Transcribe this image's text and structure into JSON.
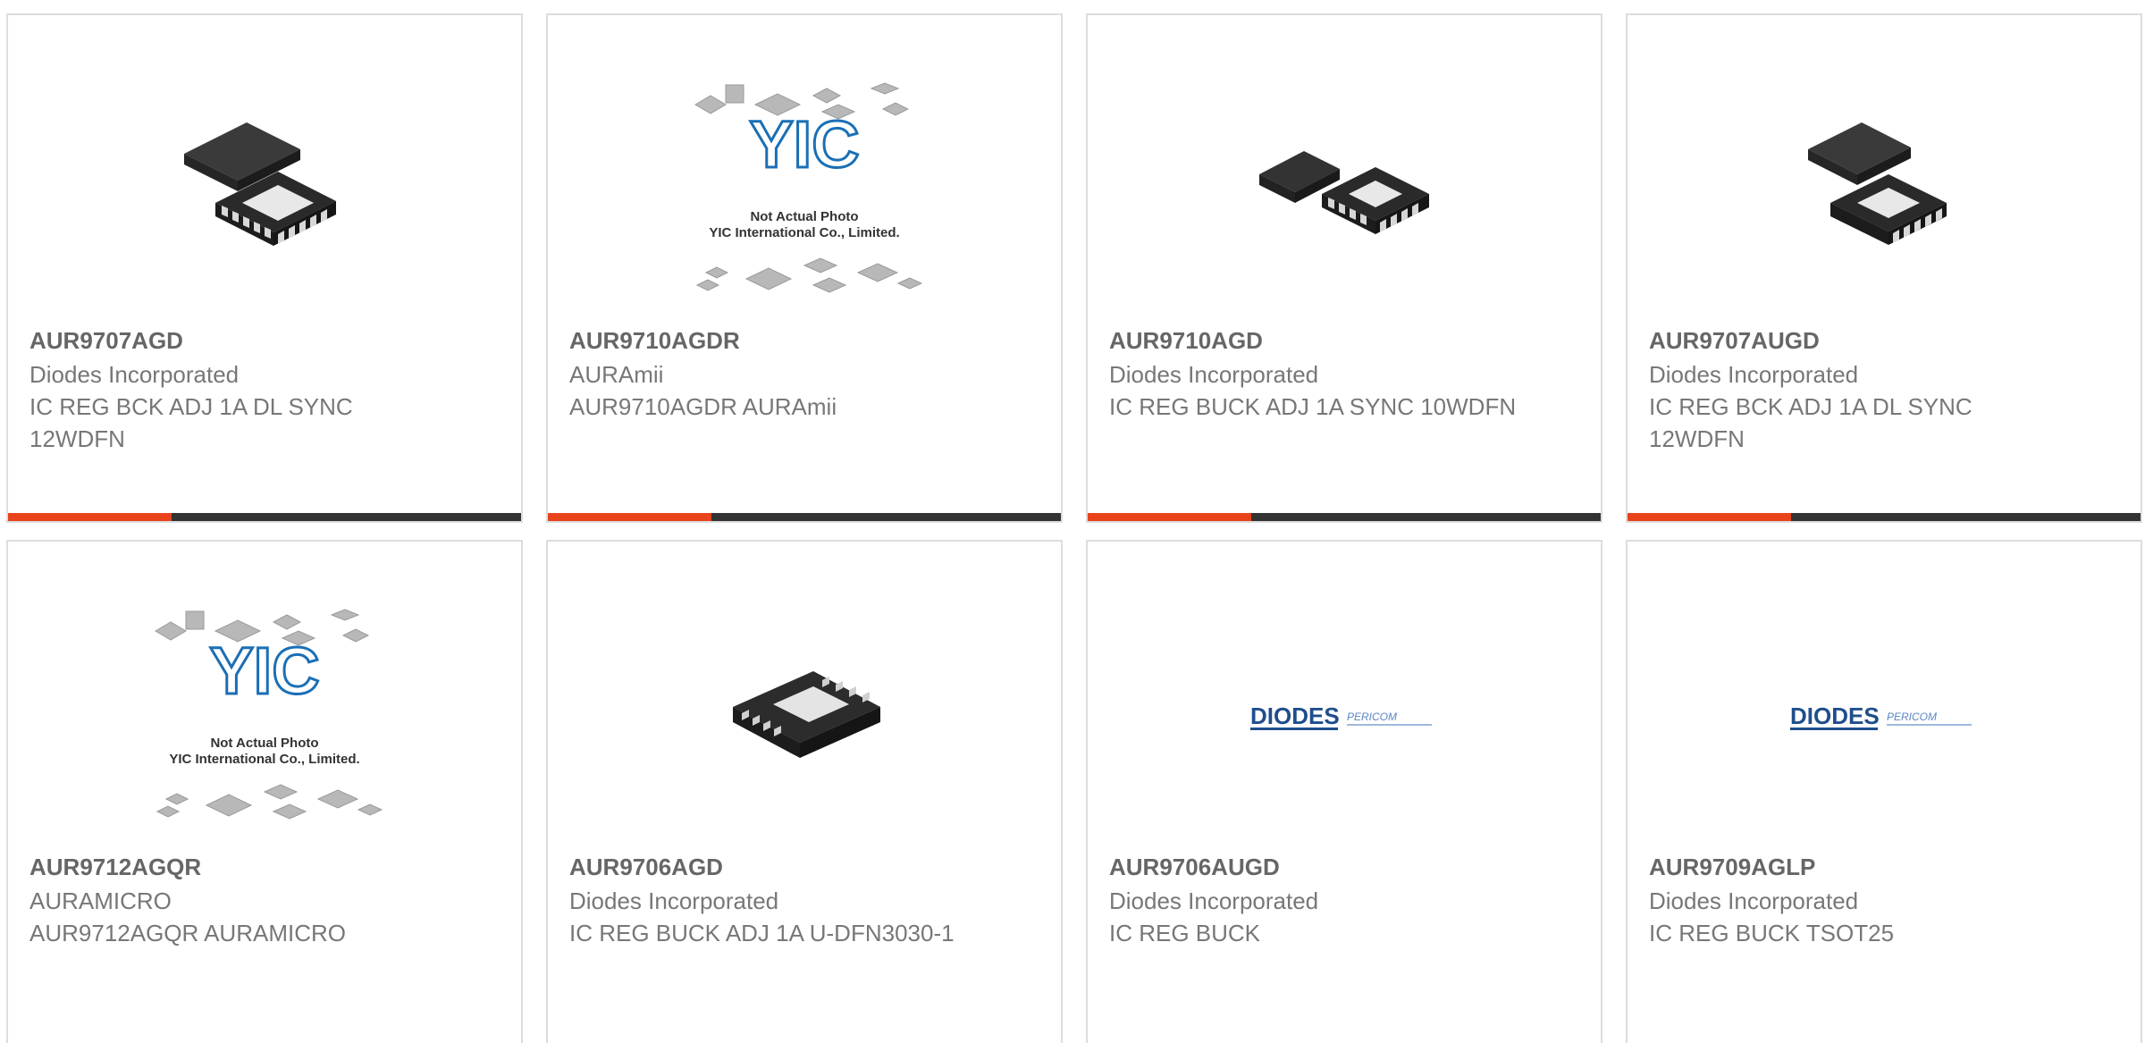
{
  "products": [
    {
      "part_number": "AUR9707AGD",
      "manufacturer": "Diodes Incorporated",
      "description": "IC REG BCK ADJ 1A DL SYNC 12WDFN",
      "image": "chip-stacked-icon"
    },
    {
      "part_number": "AUR9710AGDR",
      "manufacturer": "AURAmii",
      "description": "AUR9710AGDR AURAmii",
      "image": "placeholder-icon",
      "image_caption_line1": "Not Actual Photo",
      "image_caption_line2": "YIC International Co., Limited.",
      "image_logo": "YIC"
    },
    {
      "part_number": "AUR9710AGD",
      "manufacturer": "Diodes Incorporated",
      "description": "IC REG BUCK ADJ 1A SYNC 10WDFN",
      "image": "chip-pair-icon"
    },
    {
      "part_number": "AUR9707AUGD",
      "manufacturer": "Diodes Incorporated",
      "description": "IC REG BCK ADJ 1A DL SYNC 12WDFN",
      "image": "chip-stacked-icon"
    },
    {
      "part_number": "AUR9712AGQR",
      "manufacturer": "AURAMICRO",
      "description": "AUR9712AGQR AURAMICRO",
      "image": "placeholder-icon",
      "image_caption_line1": "Not Actual Photo",
      "image_caption_line2": "YIC International Co., Limited.",
      "image_logo": "YIC"
    },
    {
      "part_number": "AUR9706AGD",
      "manufacturer": "Diodes Incorporated",
      "description": "IC REG BUCK ADJ 1A U-DFN3030-1",
      "image": "chip-single-icon"
    },
    {
      "part_number": "AUR9706AUGD",
      "manufacturer": "Diodes Incorporated",
      "description": "IC REG BUCK",
      "image": "diodes-logo-icon",
      "logo_text": "DIODES",
      "logo_text2": "PERICOM"
    },
    {
      "part_number": "AUR9709AGLP",
      "manufacturer": "Diodes Incorporated",
      "description": "IC REG BUCK TSOT25",
      "image": "diodes-logo-icon",
      "logo_text": "DIODES",
      "logo_text2": "PERICOM"
    }
  ],
  "colors": {
    "accent": "#e8431a",
    "bar": "#333333",
    "border": "#dddddd",
    "text": "#777777",
    "yic_blue": "#1a6fb5",
    "diodes_blue": "#1f4e8c"
  }
}
